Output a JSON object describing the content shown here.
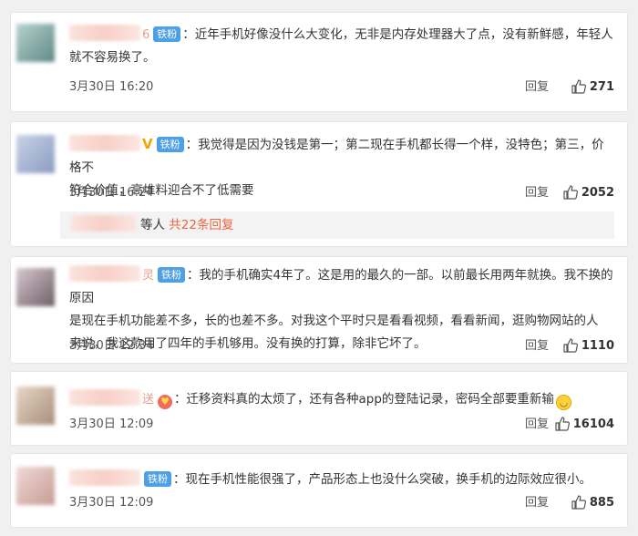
{
  "comments": [
    {
      "name_tail": "6",
      "badge": "铁粉",
      "text_line1": "：近年手机好像没什么大变化，无非是内存处理器大了点，没有新鲜感，年轻人",
      "text_line2": "就不容易换了。",
      "time": "3月30日 16:20",
      "reply": "回复",
      "likes": "271",
      "avatar_colors": [
        "#b7d2cf",
        "#5e8a86"
      ]
    },
    {
      "vip": "V",
      "badge": "铁粉",
      "text_line1": "：我觉得是因为没钱是第一；第二现在手机都长得一个样，没特色；第三，价格不",
      "text_line2": "符合价值，高堆料迎合不了低需要",
      "time": "3月30日 16:24",
      "reply": "回复",
      "likes": "2052",
      "sub_who": "等人",
      "sub_count": "共22条回复",
      "avatar_colors": [
        "#c9d3e6",
        "#8b9bc2"
      ]
    },
    {
      "name_tail": "灵",
      "badge": "铁粉",
      "text_line1": "：我的手机确实4年了。这是用的最久的一部。以前最长用两年就换。我不换的原因",
      "text_line2": "是现在手机功能差不多，长的也差不多。对我这个平时只是看看视频，看看新闻，逛购物网站的人",
      "text_line3": "来说，我这款用了四年的手机够用。没有换的打算，除非它坏了。",
      "time": "3月30日 12:34",
      "reply": "回复",
      "likes": "1110",
      "avatar_colors": [
        "#d7c9cf",
        "#6f5f66"
      ]
    },
    {
      "name_tail": "送",
      "text_line1": "：迁移资料真的太烦了，还有各种app的登陆记录，密码全部要重新输",
      "time": "3月30日 12:09",
      "reply": "回复",
      "likes": "16104",
      "avatar_colors": [
        "#e7d7c8",
        "#a88f79"
      ]
    },
    {
      "badge": "铁粉",
      "text_line1": "：现在手机性能很强了，产品形态上也没什么突破，换手机的边际效应很小。",
      "time": "3月30日 12:09",
      "reply": "回复",
      "likes": "885",
      "avatar_colors": [
        "#f0dad6",
        "#c79b94"
      ]
    }
  ]
}
